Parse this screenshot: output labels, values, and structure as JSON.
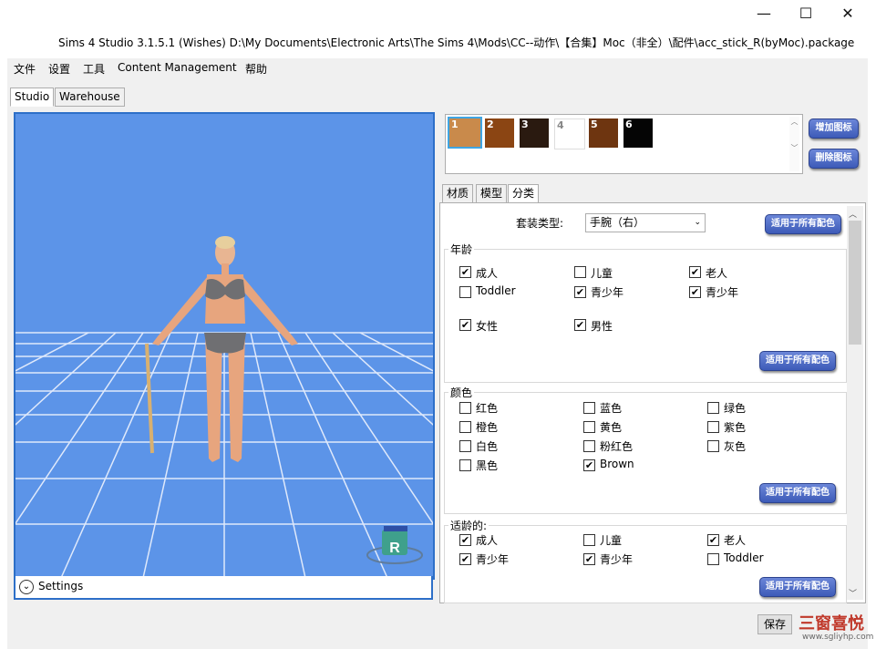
{
  "window": {
    "title": "Sims 4 Studio 3.1.5.1 (Wishes)  D:\\My Documents\\Electronic Arts\\The Sims 4\\Mods\\CC--动作\\【合集】Moc（非全）\\配件\\acc_stick_R(byMoc).package",
    "minimize": "—",
    "maximize": "☐",
    "close": "✕"
  },
  "menu": [
    "文件",
    "设置",
    "工具",
    "Content Management",
    "帮助"
  ],
  "tabs": [
    "Studio",
    "Warehouse"
  ],
  "viewport": {
    "settings_label": "Settings",
    "marker_label": "R"
  },
  "swatches": [
    {
      "label": "1",
      "color": "#c98a4b"
    },
    {
      "label": "2",
      "color": "#8b4513"
    },
    {
      "label": "3",
      "color": "#2a1a10"
    },
    {
      "label": "4",
      "color": "#ffffff"
    },
    {
      "label": "5",
      "color": "#6e3510"
    },
    {
      "label": "6",
      "color": "#050505"
    }
  ],
  "swatch_buttons": {
    "add": "增加图标",
    "remove": "删除图标"
  },
  "subtabs": [
    "材质",
    "模型",
    "分类"
  ],
  "outfit": {
    "label": "套装类型:",
    "value": "手腕（右）",
    "apply": "适用于所有配色"
  },
  "age_group": {
    "title": "年龄",
    "items": [
      {
        "label": "成人",
        "checked": true
      },
      {
        "label": "儿童",
        "checked": false
      },
      {
        "label": "老人",
        "checked": true
      },
      {
        "label": "Toddler",
        "checked": false
      },
      {
        "label": "青少年",
        "checked": true
      },
      {
        "label": "青少年",
        "checked": true
      }
    ],
    "gender": [
      {
        "label": "女性",
        "checked": true
      },
      {
        "label": "男性",
        "checked": true
      }
    ],
    "apply": "适用于所有配色"
  },
  "color_group": {
    "title": "颜色",
    "items": [
      {
        "label": "红色",
        "checked": false
      },
      {
        "label": "蓝色",
        "checked": false
      },
      {
        "label": "绿色",
        "checked": false
      },
      {
        "label": "橙色",
        "checked": false
      },
      {
        "label": "黄色",
        "checked": false
      },
      {
        "label": "紫色",
        "checked": false
      },
      {
        "label": "白色",
        "checked": false
      },
      {
        "label": "粉红色",
        "checked": false
      },
      {
        "label": "灰色",
        "checked": false
      },
      {
        "label": "黑色",
        "checked": false
      },
      {
        "label": "Brown",
        "checked": true
      }
    ],
    "apply": "适用于所有配色"
  },
  "suitable_group": {
    "title": "适龄的:",
    "items": [
      {
        "label": "成人",
        "checked": true
      },
      {
        "label": "儿童",
        "checked": false
      },
      {
        "label": "老人",
        "checked": true
      },
      {
        "label": "青少年",
        "checked": true
      },
      {
        "label": "青少年",
        "checked": true
      },
      {
        "label": "Toddler",
        "checked": false
      }
    ],
    "apply": "适用于所有配色"
  },
  "footer": {
    "save": "保存",
    "watermark": "三窗喜悦",
    "watermark_url": "www.sgliyhp.com"
  },
  "colors": {
    "accent": "#2d6fc8",
    "viewport_bg": "#5c94e8",
    "button_blue": "#3d5bb8"
  }
}
